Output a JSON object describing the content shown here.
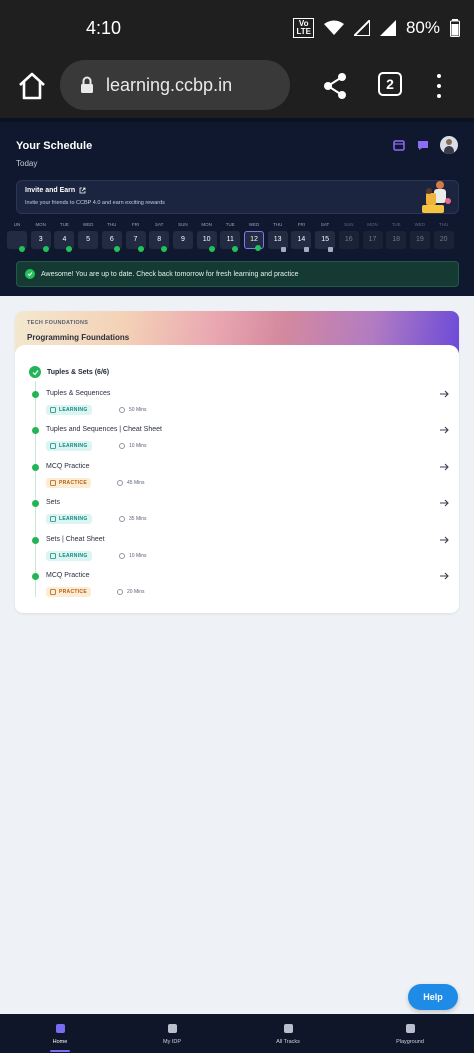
{
  "status_bar": {
    "time": "4:10",
    "volte": "Vo LTE",
    "wifi_label": "WiFi",
    "battery": "80%"
  },
  "browser": {
    "url": "learning.ccbp.in",
    "tab_count": "2"
  },
  "schedule": {
    "title": "Your Schedule",
    "today_label": "Today",
    "invite": {
      "title": "Invite and Earn",
      "subtitle": "Invite your friends to CCBP 4.0 and earn exciting rewards"
    },
    "days": [
      {
        "label": "UN",
        "num": "",
        "state": "done"
      },
      {
        "label": "MON",
        "num": "3",
        "state": "done"
      },
      {
        "label": "TUE",
        "num": "4",
        "state": "done"
      },
      {
        "label": "WED",
        "num": "5",
        "state": "none"
      },
      {
        "label": "THU",
        "num": "6",
        "state": "done"
      },
      {
        "label": "FRI",
        "num": "7",
        "state": "done"
      },
      {
        "label": "SAT",
        "num": "8",
        "state": "done"
      },
      {
        "label": "SUN",
        "num": "9",
        "state": "none"
      },
      {
        "label": "MON",
        "num": "10",
        "state": "done"
      },
      {
        "label": "TUE",
        "num": "11",
        "state": "done"
      },
      {
        "label": "WED",
        "num": "12",
        "state": "current"
      },
      {
        "label": "THU",
        "num": "13",
        "state": "locked"
      },
      {
        "label": "FRI",
        "num": "14",
        "state": "locked"
      },
      {
        "label": "SAT",
        "num": "15",
        "state": "locked"
      },
      {
        "label": "SUN",
        "num": "16",
        "state": "future"
      },
      {
        "label": "MON",
        "num": "17",
        "state": "future"
      },
      {
        "label": "TUE",
        "num": "18",
        "state": "future"
      },
      {
        "label": "WED",
        "num": "19",
        "state": "future"
      },
      {
        "label": "THU",
        "num": "20",
        "state": "future"
      }
    ],
    "message": "Awesome! You are up to date. Check back tomorrow for fresh learning and practice"
  },
  "course": {
    "category": "TECH FOUNDATIONS",
    "title": "Programming Foundations",
    "group": "Tuples & Sets (6/6)",
    "items": [
      {
        "title": "Tuples & Sequences",
        "type": "LEARNING",
        "duration": "50 Mins"
      },
      {
        "title": "Tuples and Sequences | Cheat Sheet",
        "type": "LEARNING",
        "duration": "10 Mins"
      },
      {
        "title": "MCQ Practice",
        "type": "PRACTICE",
        "duration": "45 Mins"
      },
      {
        "title": "Sets",
        "type": "LEARNING",
        "duration": "35 Mins"
      },
      {
        "title": "Sets | Cheat Sheet",
        "type": "LEARNING",
        "duration": "10 Mins"
      },
      {
        "title": "MCQ Practice",
        "type": "PRACTICE",
        "duration": "20 Mins"
      }
    ]
  },
  "help_label": "Help",
  "nav": [
    {
      "label": "Home",
      "active": true
    },
    {
      "label": "My IDP",
      "active": false
    },
    {
      "label": "All Tracks",
      "active": false
    },
    {
      "label": "Playground",
      "active": false
    }
  ],
  "colors": {
    "accent": "#7a6cf2",
    "success": "#22b457",
    "help": "#1e8ce6"
  }
}
